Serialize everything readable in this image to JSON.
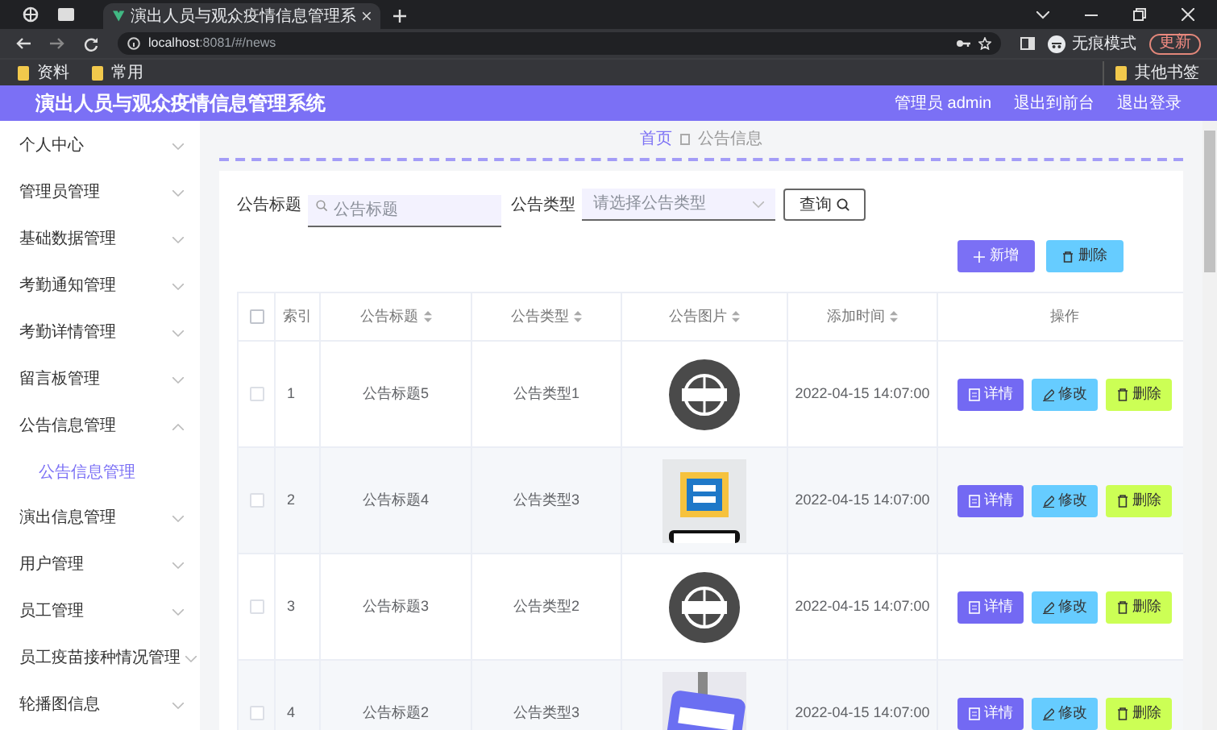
{
  "browser": {
    "tab_title": "演出人员与观众疫情信息管理系",
    "url_host": "localhost",
    "url_rest": ":8081/#/news",
    "profile": "无痕模式",
    "update": "更新",
    "bookmarks": [
      "资料",
      "常用"
    ],
    "other_bookmarks": "其他书签"
  },
  "header": {
    "title": "演出人员与观众疫情信息管理系统",
    "links": [
      "管理员 admin",
      "退出到前台",
      "退出登录"
    ]
  },
  "sidebar": {
    "items": [
      {
        "label": "个人中心",
        "expanded": false
      },
      {
        "label": "管理员管理",
        "expanded": false
      },
      {
        "label": "基础数据管理",
        "expanded": false
      },
      {
        "label": "考勤通知管理",
        "expanded": false
      },
      {
        "label": "考勤详情管理",
        "expanded": false
      },
      {
        "label": "留言板管理",
        "expanded": false
      },
      {
        "label": "公告信息管理",
        "expanded": true,
        "children": [
          {
            "label": "公告信息管理",
            "selected": true
          }
        ]
      },
      {
        "label": "演出信息管理",
        "expanded": false
      },
      {
        "label": "用户管理",
        "expanded": false
      },
      {
        "label": "员工管理",
        "expanded": false
      },
      {
        "label": "员工疫苗接种情况管理",
        "expanded": false
      },
      {
        "label": "轮播图信息",
        "expanded": false
      }
    ]
  },
  "breadcrumb": [
    "首页",
    "公告信息"
  ],
  "search": {
    "title_label": "公告标题",
    "title_placeholder": "公告标题",
    "type_label": "公告类型",
    "type_placeholder": "请选择公告类型",
    "button": "查询"
  },
  "actions": [
    "新增",
    "删除"
  ],
  "table": {
    "select_all_checked": false,
    "columns": [
      {
        "label": "索引",
        "sortable": false
      },
      {
        "label": "公告标题",
        "sortable": true
      },
      {
        "label": "公告类型",
        "sortable": true
      },
      {
        "label": "公告图片",
        "sortable": true
      },
      {
        "label": "添加时间",
        "sortable": true
      },
      {
        "label": "操作",
        "sortable": false
      }
    ],
    "rows": [
      {
        "checked": false,
        "index": "1",
        "title": "公告标题5",
        "type": "公告类型1",
        "time": "2022-04-15 14:07:00",
        "buttons": [
          "详情",
          "修改",
          "删除"
        ]
      },
      {
        "checked": false,
        "index": "2",
        "title": "公告标题4",
        "type": "公告类型3",
        "time": "2022-04-15 14:07:00",
        "buttons": [
          "详情",
          "修改",
          "删除"
        ]
      },
      {
        "checked": false,
        "index": "3",
        "title": "公告标题3",
        "type": "公告类型2",
        "time": "2022-04-15 14:07:00",
        "buttons": [
          "详情",
          "修改",
          "删除"
        ]
      },
      {
        "checked": false,
        "index": "4",
        "title": "公告标题2",
        "type": "公告类型3",
        "time": "2022-04-15 14:07:00",
        "buttons": [
          "详情",
          "修改",
          "删除"
        ]
      }
    ]
  }
}
